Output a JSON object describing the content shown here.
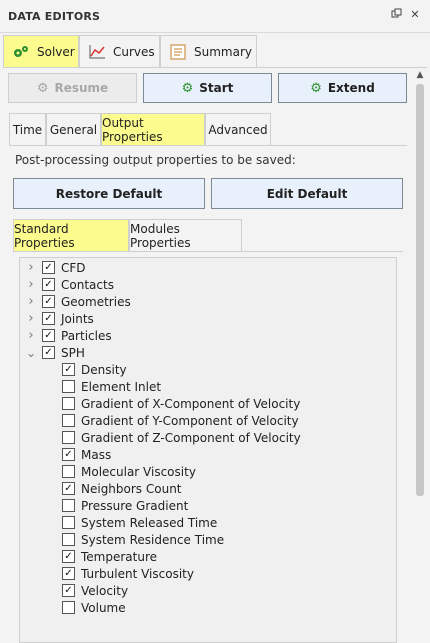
{
  "panel": {
    "title": "DATA EDITORS"
  },
  "top_tabs": [
    {
      "label": "Solver",
      "active": true,
      "icon": "gears-icon"
    },
    {
      "label": "Curves",
      "active": false,
      "icon": "chart-icon"
    },
    {
      "label": "Summary",
      "active": false,
      "icon": "summary-icon"
    }
  ],
  "actions": {
    "resume": "Resume",
    "start": "Start",
    "extend": "Extend"
  },
  "sub_tabs": [
    {
      "label": "Time",
      "active": false
    },
    {
      "label": "General",
      "active": false
    },
    {
      "label": "Output Properties",
      "active": true
    },
    {
      "label": "Advanced",
      "active": false
    }
  ],
  "description": "Post-processing output properties to be saved:",
  "defaults": {
    "restore": "Restore Default",
    "edit": "Edit Default"
  },
  "prop_tabs": [
    {
      "label": "Standard Properties",
      "active": true
    },
    {
      "label": "Modules Properties",
      "active": false
    }
  ],
  "tree": {
    "groups": [
      {
        "label": "CFD",
        "expanded": false,
        "checked": true
      },
      {
        "label": "Contacts",
        "expanded": false,
        "checked": true
      },
      {
        "label": "Geometries",
        "expanded": false,
        "checked": true
      },
      {
        "label": "Joints",
        "expanded": false,
        "checked": true
      },
      {
        "label": "Particles",
        "expanded": false,
        "checked": true
      },
      {
        "label": "SPH",
        "expanded": true,
        "checked": true
      }
    ],
    "sph_children": [
      {
        "label": "Density",
        "checked": true
      },
      {
        "label": "Element Inlet",
        "checked": false
      },
      {
        "label": "Gradient of X-Component of Velocity",
        "checked": false
      },
      {
        "label": "Gradient of Y-Component of Velocity",
        "checked": false
      },
      {
        "label": "Gradient of Z-Component of Velocity",
        "checked": false
      },
      {
        "label": "Mass",
        "checked": true
      },
      {
        "label": "Molecular Viscosity",
        "checked": false
      },
      {
        "label": "Neighbors Count",
        "checked": true
      },
      {
        "label": "Pressure Gradient",
        "checked": false
      },
      {
        "label": "System Released Time",
        "checked": false
      },
      {
        "label": "System Residence Time",
        "checked": false
      },
      {
        "label": "Temperature",
        "checked": true
      },
      {
        "label": "Turbulent Viscosity",
        "checked": true
      },
      {
        "label": "Velocity",
        "checked": true
      },
      {
        "label": "Volume",
        "checked": false
      }
    ]
  },
  "colors": {
    "active_tab": "#fbfb8e",
    "button_bg": "#e8f1fb",
    "accent_green": "#2f8f2f"
  }
}
